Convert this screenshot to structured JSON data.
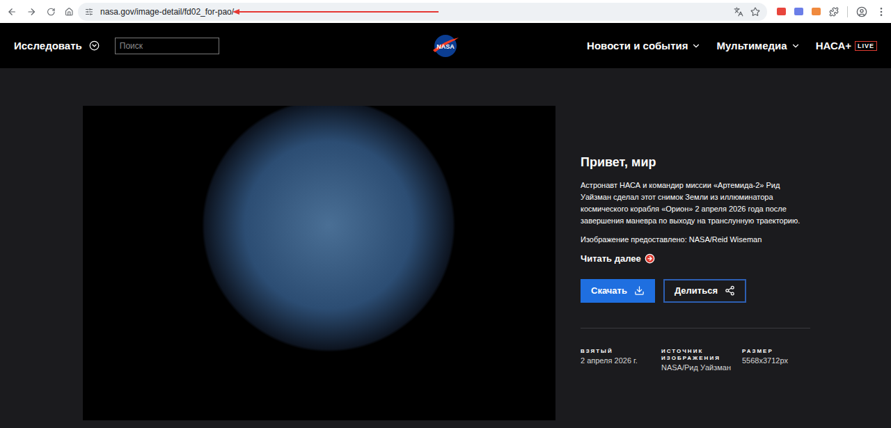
{
  "browser": {
    "url": "nasa.gov/image-detail/fd02_for-pao/"
  },
  "header": {
    "explore": "Исследовать",
    "search": {
      "placeholder": "Поиск"
    },
    "logo": "NASA",
    "nav": [
      {
        "label": "Новости и события",
        "badge": ""
      },
      {
        "label": "Мультимедиа",
        "badge": ""
      },
      {
        "label": "НАСА+",
        "badge": "LIVE"
      }
    ]
  },
  "detail": {
    "title": "Привет, мир",
    "description": "Астронавт НАСА и командир миссии «Артемида-2» Рид Уайзман сделал этот снимок Земли из иллюминатора космического корабля «Орион» 2 апреля 2026 года после завершения маневра по выходу на транслунную траекторию.",
    "credit": "Изображение предоставлено: NASA/Reid Wiseman",
    "read_more": "Читать далее",
    "buttons": [
      {
        "label": "Скачать",
        "kind": "primary"
      },
      {
        "label": "Делиться",
        "kind": "outline"
      }
    ],
    "meta": [
      {
        "label": "ВЗЯТЫЙ",
        "value": "2 апреля 2026 г."
      },
      {
        "label": "ИСТОЧНИК ИЗОБРАЖЕНИЯ",
        "value": "NASA/Рид Уайзман"
      },
      {
        "label": "РАЗМЕР",
        "value": "5568x3712px"
      }
    ]
  }
}
